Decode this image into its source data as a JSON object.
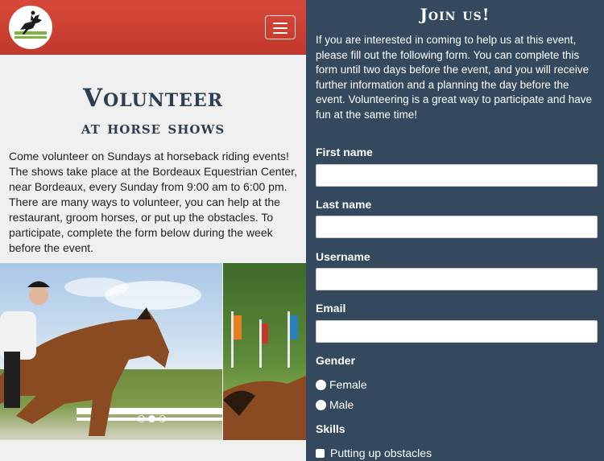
{
  "page": {
    "title": "Volunteer",
    "subtitle": "at horse shows",
    "intro": "Come volunteer on Sundays at horseback riding events! The shows take place at the Bordeaux Equestrian Center, near Bordeaux, every Sunday from 9:00 am to 6:00 pm. There are many ways to volunteer, you can help at the restaurant, groom horses, or put up the obstacles. To participate, complete the form below during the week before the event."
  },
  "navbar": {
    "logo": "show-jumping-horse-logo-icon",
    "menu_icon": "hamburger-menu-icon",
    "brand_color": "#c0392b"
  },
  "carousel": {
    "slides": [
      "rider-jumping-horse-photo",
      "horse-on-field-photo"
    ],
    "indicators": 3,
    "active_index": 1
  },
  "form": {
    "title": "Join us!",
    "intro": "If you are interested in coming to help us at this event, please fill out the following form. You can complete this form until two days before the event, and you will receive further information and a planning the day before the event. Volunteering is a great way to participate and have fun at the same time!",
    "fields": [
      {
        "label": "First name",
        "value": ""
      },
      {
        "label": "Last name",
        "value": ""
      },
      {
        "label": "Username",
        "value": ""
      },
      {
        "label": "Email",
        "value": ""
      }
    ],
    "gender": {
      "label": "Gender",
      "options": [
        "Female",
        "Male"
      ]
    },
    "skills": {
      "label": "Skills",
      "options": [
        "Putting up obstacles"
      ]
    },
    "panel_color": "#34495e"
  }
}
